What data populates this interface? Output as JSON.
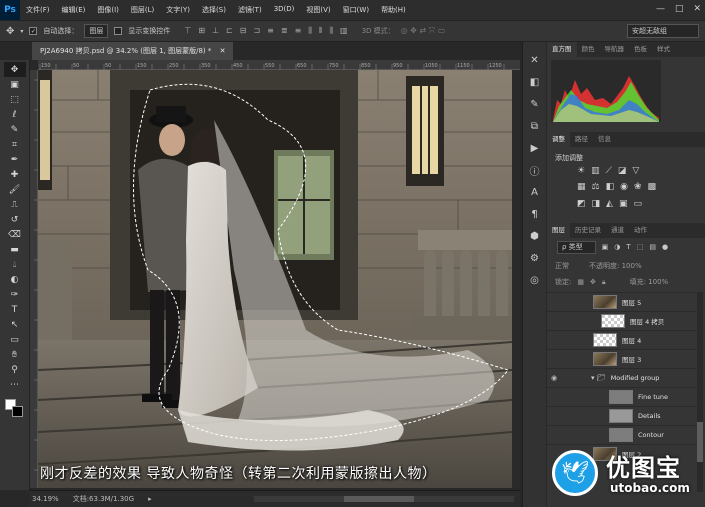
{
  "app": {
    "logo": "Ps"
  },
  "menu": [
    "文件(F)",
    "编辑(E)",
    "图像(I)",
    "图层(L)",
    "文字(Y)",
    "选择(S)",
    "滤镜(T)",
    "3D(D)",
    "视图(V)",
    "窗口(W)",
    "帮助(H)"
  ],
  "window_controls": {
    "minimize": "—",
    "restore": "□",
    "close": "✕"
  },
  "options": {
    "auto_select_label": "自动选择：",
    "auto_select_value": "图层",
    "show_transform_label": "显示变换控件",
    "mode_3d": "3D 模式：",
    "workspace": "安超无敌组"
  },
  "document": {
    "tab_title": "PJ2A6940 拷贝.psd @ 34.2% (图层 1, 图层蒙版/8) *",
    "ruler_ticks": [
      "150",
      "100",
      "50",
      "0",
      "50",
      "100",
      "150",
      "200",
      "250",
      "300",
      "350",
      "400",
      "450",
      "500",
      "550",
      "600",
      "650",
      "700",
      "750",
      "800",
      "850",
      "900",
      "950",
      "1000",
      "1050",
      "1100",
      "1150",
      "1200",
      "1250",
      "1300",
      "1350",
      "1400",
      "1450",
      "1500",
      "1550",
      "1600",
      "1650",
      "1700",
      "1750",
      "1800",
      "1850",
      "1900",
      "1950",
      "2000",
      "2050",
      "2100",
      "2150",
      "2200",
      "2250",
      "2300",
      "2350",
      "2400",
      "2450",
      "2500",
      "2550",
      "2600",
      "2650",
      "2700",
      "2750",
      "2800",
      "2850",
      "2900",
      "2950",
      "3000",
      "3050",
      "3100",
      "3150",
      "3200",
      "3250",
      "3300",
      "3350",
      "3400",
      "3450",
      "3500",
      "3550",
      "3600",
      "3650",
      "3700",
      "3750",
      "3800",
      "3850",
      "3900",
      "3950",
      "4000",
      "4050",
      "4100",
      "4150",
      "4200",
      "4250",
      "4300",
      "4350",
      "4400",
      "4450",
      "4500",
      "4550",
      "4600",
      "4650",
      "4700",
      "4750",
      "4800",
      "4850",
      "4900",
      "4950",
      "5000",
      "5050",
      "5100",
      "5150",
      "5200",
      "5250"
    ],
    "caption": "刚才反差的效果 导致人物奇怪（转第二次利用蒙版擦出人物）"
  },
  "status": {
    "zoom": "34.19%",
    "doc_info": "文档:63.3M/1.30G"
  },
  "tools": [
    "移动",
    "画板",
    "矩形选框",
    "套索",
    "快速选择",
    "裁剪",
    "吸管",
    "修复画笔",
    "画笔",
    "仿制图章",
    "历史记录画笔",
    "橡皮擦",
    "渐变",
    "模糊",
    "减淡",
    "钢笔",
    "文字",
    "路径选择",
    "矩形",
    "抓手",
    "缩放",
    "更多"
  ],
  "panels": {
    "top_tabs": [
      "直方图",
      "颜色",
      "导航器",
      "色板",
      "样式"
    ],
    "adj_tabs": [
      "调整",
      "路径",
      "信息"
    ],
    "adj_title": "添加调整",
    "layers_tabs": [
      "图层",
      "历史记录",
      "通道",
      "动作"
    ],
    "kind_filter": "ρ 类型",
    "blend_mode": "正常",
    "opacity_label": "不透明度: 100%",
    "lock_label": "锁定:",
    "fill_label": "填充: 100%"
  },
  "layers": [
    {
      "name": "图层 5",
      "thumb": "photo",
      "indent": 0,
      "visible": false
    },
    {
      "name": "图层 4 拷贝",
      "thumb": "checker",
      "indent": 1,
      "visible": false
    },
    {
      "name": "图层 4",
      "thumb": "checker",
      "indent": 0,
      "visible": false
    },
    {
      "name": "图层 3",
      "thumb": "photo",
      "indent": 0,
      "visible": false
    },
    {
      "name": "Modified group",
      "thumb": "folder",
      "indent": 0,
      "visible": true
    },
    {
      "name": "Fine tune",
      "thumb": "gray",
      "indent": 2,
      "visible": false
    },
    {
      "name": "Details",
      "thumb": "gray2",
      "indent": 2,
      "visible": false
    },
    {
      "name": "Contour",
      "thumb": "gray",
      "indent": 2,
      "visible": false
    },
    {
      "name": "图层 2",
      "thumb": "photo",
      "indent": 0,
      "visible": false
    }
  ],
  "watermark": {
    "cn": "优图宝",
    "url": "utobao.com"
  }
}
